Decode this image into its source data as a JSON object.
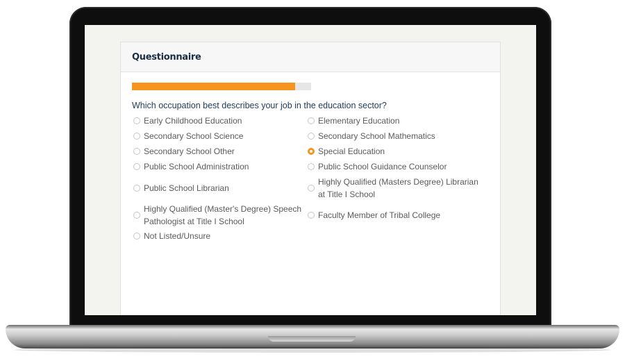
{
  "card": {
    "title": "Questionnaire"
  },
  "progress": {
    "fraction": 0.91
  },
  "question": {
    "text": "Which occupation best describes your job in the education sector?",
    "options": [
      {
        "label": "Early Childhood Education",
        "selected": false
      },
      {
        "label": "Elementary Education",
        "selected": false
      },
      {
        "label": "Secondary School Science",
        "selected": false
      },
      {
        "label": "Secondary School Mathematics",
        "selected": false
      },
      {
        "label": "Secondary School Other",
        "selected": false
      },
      {
        "label": "Special Education",
        "selected": true
      },
      {
        "label": "Public School Administration",
        "selected": false
      },
      {
        "label": "Public School Guidance Counselor",
        "selected": false
      },
      {
        "label": "Public School Librarian",
        "selected": false
      },
      {
        "label": "Highly Qualified (Masters Degree) Librarian at Title I School",
        "selected": false
      },
      {
        "label": "Highly Qualified (Master's Degree) Speech Pathologist at Title I School",
        "selected": false
      },
      {
        "label": "Faculty Member of Tribal College",
        "selected": false
      },
      {
        "label": "Not Listed/Unsure",
        "selected": false
      }
    ]
  },
  "colors": {
    "accent": "#f7941d",
    "title": "#1a2d45",
    "question": "#1f3b57",
    "option_text": "#5b5b5b"
  }
}
